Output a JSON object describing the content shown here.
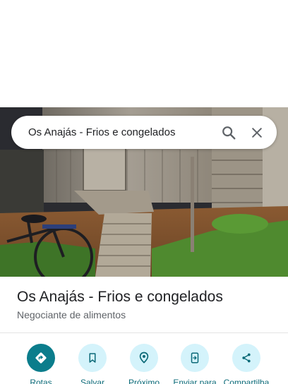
{
  "search": {
    "query": "Os Anajás - Frios e congelados",
    "search_icon": "search-icon",
    "close_icon": "close-icon"
  },
  "place": {
    "name": "Os Anajás - Frios e congelados",
    "category": "Negociante de alimentos"
  },
  "actions": [
    {
      "label": "Rotas",
      "icon": "directions-icon"
    },
    {
      "label": "Salvar",
      "icon": "bookmark-icon"
    },
    {
      "label": "Próximo",
      "icon": "nearby-icon"
    },
    {
      "label": "Enviar para",
      "icon": "send-to-phone-icon"
    },
    {
      "label": "Compartilha",
      "icon": "share-icon"
    }
  ],
  "colors": {
    "primary_action": "#0b7d8c",
    "action_bg": "#d4f3fb",
    "action_label": "#0b6a78"
  }
}
